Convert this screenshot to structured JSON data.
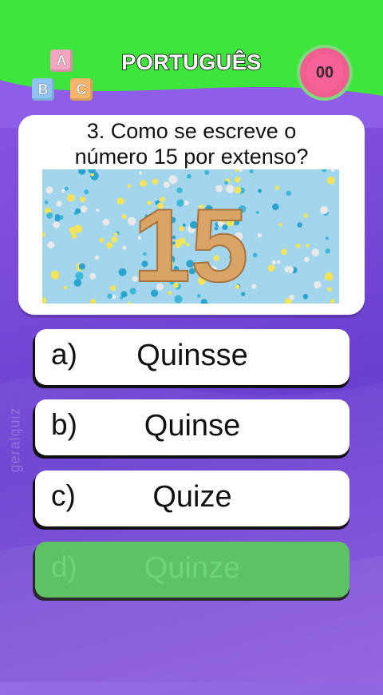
{
  "header": {
    "logo_letters": [
      "A",
      "B",
      "C"
    ],
    "title": "PORTUGUÊS",
    "score": "00"
  },
  "question": {
    "line1": "3. Como se escreve o",
    "line2": "número 15 por extenso?",
    "image_number": "15"
  },
  "options": [
    {
      "letter": "a)",
      "text": "Quinsse"
    },
    {
      "letter": "b)",
      "text": "Quinse"
    },
    {
      "letter": "c)",
      "text": "Quize"
    },
    {
      "letter": "d)",
      "text": "Quinze"
    }
  ],
  "watermark": "geralquiz",
  "colors": {
    "top_band": "#3ee53a",
    "background": "#7b4bd8",
    "correct_answer": "#5ec163",
    "score_badge": "#ef5e8e"
  }
}
